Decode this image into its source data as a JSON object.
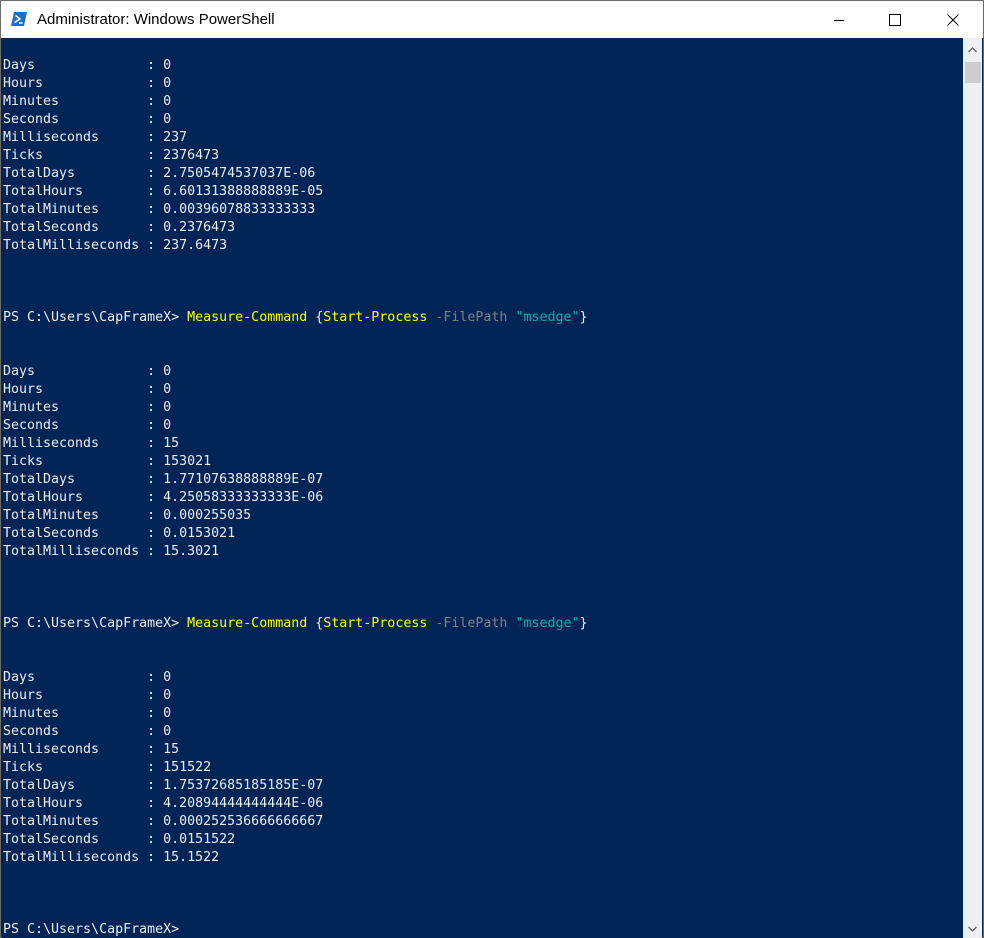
{
  "window": {
    "title": "Administrator: Windows PowerShell",
    "colors": {
      "console_bg": "#012456",
      "console_fg": "#eeedf0",
      "cmdlet": "#ffff00",
      "parameter": "#808080",
      "string": "#00b2a5"
    }
  },
  "controls": {
    "minimize": "minimize-icon",
    "maximize": "maximize-icon",
    "close": "close-icon"
  },
  "timespan_keys": [
    "Days",
    "Hours",
    "Minutes",
    "Seconds",
    "Milliseconds",
    "Ticks",
    "TotalDays",
    "TotalHours",
    "TotalMinutes",
    "TotalSeconds",
    "TotalMilliseconds"
  ],
  "blocks": [
    {
      "values": [
        "0",
        "0",
        "0",
        "0",
        "237",
        "2376473",
        "2.7505474537037E-06",
        "6.60131388888889E-05",
        "0.00396078833333333",
        "0.2376473",
        "237.6473"
      ]
    },
    {
      "prompt": "PS C:\\Users\\CapFrameX>",
      "command": {
        "cmdlet": "Measure-Command",
        "open": "{",
        "inner_cmdlet": "Start-Process",
        "param": "-FilePath",
        "arg": "\"msedge\"",
        "close": "}"
      },
      "values": [
        "0",
        "0",
        "0",
        "0",
        "15",
        "153021",
        "1.77107638888889E-07",
        "4.25058333333333E-06",
        "0.000255035",
        "0.0153021",
        "15.3021"
      ]
    },
    {
      "prompt": "PS C:\\Users\\CapFrameX>",
      "command": {
        "cmdlet": "Measure-Command",
        "open": "{",
        "inner_cmdlet": "Start-Process",
        "param": "-FilePath",
        "arg": "\"msedge\"",
        "close": "}"
      },
      "values": [
        "0",
        "0",
        "0",
        "0",
        "15",
        "151522",
        "1.75372685185185E-07",
        "4.20894444444444E-06",
        "0.000252536666666667",
        "0.0151522",
        "15.1522"
      ]
    }
  ],
  "final_prompt": "PS C:\\Users\\CapFrameX>"
}
